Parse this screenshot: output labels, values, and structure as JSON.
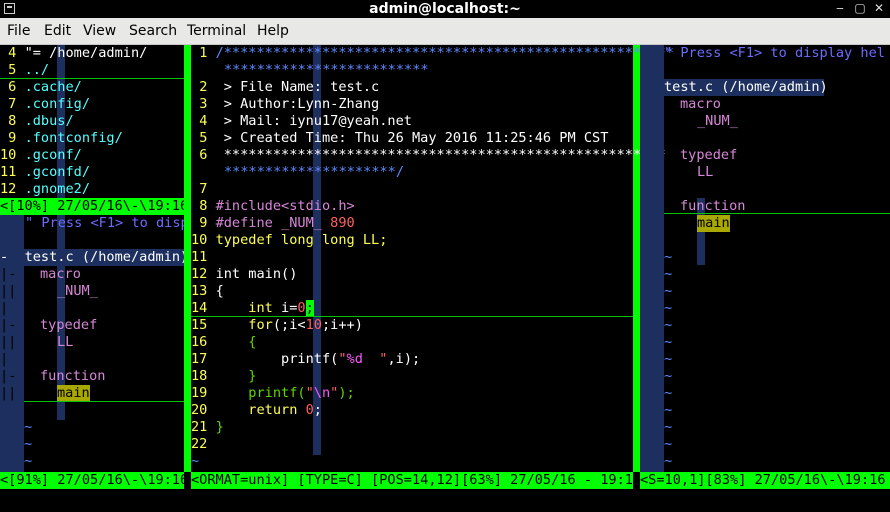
{
  "window": {
    "title": "admin@localhost:~"
  },
  "menu": [
    "File",
    "Edit",
    "View",
    "Search",
    "Terminal",
    "Help"
  ],
  "left_top_pane": {
    "lines": [
      {
        "num": " 4",
        "text": "\"= /home/admin/"
      },
      {
        "num": " 5",
        "text": "../"
      },
      {
        "num": " 6",
        "text": ".cache/"
      },
      {
        "num": " 7",
        "text": ".config/"
      },
      {
        "num": " 8",
        "text": ".dbus/"
      },
      {
        "num": " 9",
        "text": ".fontconfig/"
      },
      {
        "num": "10",
        "text": ".gconf/"
      },
      {
        "num": "11",
        "text": ".gconfd/"
      },
      {
        "num": "12",
        "text": ".gnome2/"
      }
    ],
    "status": "<[10%] 27/05/16\\-\\19:16"
  },
  "left_bottom_pane": {
    "press_hint": "\" Press <F1> to disp",
    "file_header": "test.c (/home/admin)",
    "dash": "-",
    "macro_label": "macro",
    "macro_value": "_NUM_",
    "typedef_label": "typedef",
    "typedef_value": "LL",
    "function_label": "function",
    "function_value": "main",
    "fold_markers": [
      "|-",
      "||",
      "|",
      "|-",
      "||",
      "|",
      "|-",
      "||"
    ],
    "tildes": [
      "~",
      "~",
      "~"
    ],
    "status": "<[91%] 27/05/16\\-\\19:16"
  },
  "editor_pane": {
    "header_stars_1": "/*******************************************************",
    "header_stars_1b": "*************************",
    "lines": [
      {
        "num": "2",
        "text": " > File Name: test.c"
      },
      {
        "num": "3",
        "text": " > Author:Lynn-Zhang"
      },
      {
        "num": "4",
        "text": " > Mail: iynu17@yeah.net"
      },
      {
        "num": "5",
        "text": " > Created Time: Thu 26 May 2016 11:25:46 PM CST"
      },
      {
        "num": "6",
        "text": " ******************************************************"
      }
    ],
    "header_end": "*********************/",
    "include_directive": "#include<stdio.h>",
    "define_kw": "#define",
    "define_name": "_NUM_",
    "define_val": "890",
    "typedef_line": "typedef long long LL;",
    "main_decl": "int main()",
    "brace_open": "{",
    "int_kw": "int",
    "int_decl_rest": "i=",
    "zero": "0",
    "semicolon": ";",
    "for_kw": "for",
    "for_rest_1": "(;i<",
    "ten": "10",
    "for_rest_2": ";i++)",
    "inner_open": "{",
    "printf_1": "printf(",
    "str_q1": "\"",
    "fmt_d": "%d",
    "str_sp": "  \"",
    "printf_1_rest": ",i);",
    "inner_close": "}",
    "printf_2": "printf(",
    "str_q2": "\"",
    "newline_esc": "\\n",
    "str_q3": "\"",
    "printf_2_rest": ");",
    "return_kw": "return",
    "return_val": "0",
    "return_semi": ";",
    "brace_close": "}",
    "line_numbers": [
      "1",
      "2",
      "3",
      "4",
      "5",
      "6",
      "7",
      "8",
      "9",
      "10",
      "11",
      "12",
      "13",
      "14",
      "15",
      "16",
      "17",
      "18",
      "19",
      "20",
      "21",
      "22"
    ],
    "tilde": "~",
    "status": "<ORMAT=unix] [TYPE=C] [POS=14,12][63%] 27/05/16 - 19:16"
  },
  "right_pane": {
    "press_hint": "\" Press <F1> to display hel",
    "file_header": "test.c (/home/admin)",
    "macro_label": "macro",
    "macro_value": "_NUM_",
    "typedef_label": "typedef",
    "typedef_value": "LL",
    "function_label": "function",
    "function_value": "main",
    "tilde": "~",
    "status": "<S=10,1][83%] 27/05/16\\-\\19:16"
  }
}
